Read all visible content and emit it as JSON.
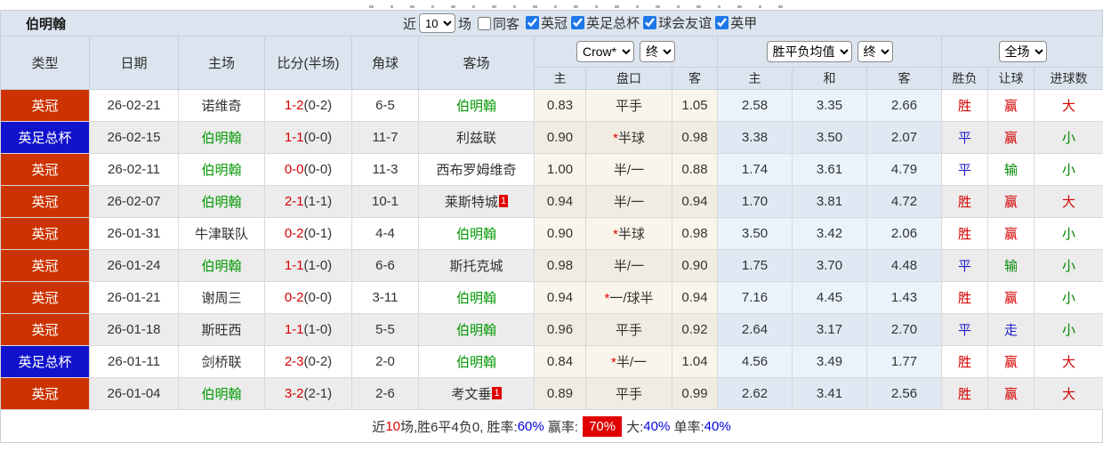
{
  "header": {
    "team": "伯明翰",
    "recent_label": "近",
    "recent_value": "10",
    "matches_label": "场",
    "same_opponent": {
      "label": "同客",
      "checked": false
    },
    "league_filters": [
      {
        "label": "英冠",
        "checked": true
      },
      {
        "label": "英足总杯",
        "checked": true
      },
      {
        "label": "球会友谊",
        "checked": true
      },
      {
        "label": "英甲",
        "checked": true
      }
    ]
  },
  "table": {
    "main_headers": [
      "类型",
      "日期",
      "主场",
      "比分(半场)",
      "角球",
      "客场"
    ],
    "selects": {
      "company": "Crow*",
      "company_time": "终",
      "mean": "胜平负均值",
      "mean_time": "终",
      "scope": "全场"
    },
    "sub_headers": [
      "主",
      "盘口",
      "客",
      "主",
      "和",
      "客",
      "胜负",
      "让球",
      "进球数"
    ],
    "rows": [
      {
        "league": "英冠",
        "league_bg": "#cc3300",
        "date": "26-02-21",
        "home": "诺维奇",
        "score": "1-2",
        "half": "(0-2)",
        "corners": "6-5",
        "away": "伯明翰",
        "odds_home": "0.83",
        "handicap": "平手",
        "odds_away": "1.05",
        "mean_home": "2.58",
        "mean_draw": "3.35",
        "mean_away": "2.66",
        "result": "胜",
        "handicap_result": "赢",
        "goals": "大"
      },
      {
        "league": "英足总杯",
        "league_bg": "#1212cc",
        "date": "26-02-15",
        "home": "伯明翰",
        "score": "1-1",
        "half": "(0-0)",
        "corners": "11-7",
        "away": "利兹联",
        "odds_home": "0.90",
        "handicap": "*半球",
        "odds_away": "0.98",
        "mean_home": "3.38",
        "mean_draw": "3.50",
        "mean_away": "2.07",
        "result": "平",
        "handicap_result": "赢",
        "goals": "小"
      },
      {
        "league": "英冠",
        "league_bg": "#cc3300",
        "date": "26-02-11",
        "home": "伯明翰",
        "score": "0-0",
        "half": "(0-0)",
        "corners": "11-3",
        "away": "西布罗姆维奇",
        "odds_home": "1.00",
        "handicap": "半/一",
        "odds_away": "0.88",
        "mean_home": "1.74",
        "mean_draw": "3.61",
        "mean_away": "4.79",
        "result": "平",
        "handicap_result": "输",
        "goals": "小"
      },
      {
        "league": "英冠",
        "league_bg": "#cc3300",
        "date": "26-02-07",
        "home": "伯明翰",
        "score": "2-1",
        "half": "(1-1)",
        "corners": "10-1",
        "away": "莱斯特城",
        "away_badge": "1",
        "odds_home": "0.94",
        "handicap": "半/一",
        "odds_away": "0.94",
        "mean_home": "1.70",
        "mean_draw": "3.81",
        "mean_away": "4.72",
        "result": "胜",
        "handicap_result": "赢",
        "goals": "大"
      },
      {
        "league": "英冠",
        "league_bg": "#cc3300",
        "date": "26-01-31",
        "home": "牛津联队",
        "score": "0-2",
        "half": "(0-1)",
        "corners": "4-4",
        "away": "伯明翰",
        "odds_home": "0.90",
        "handicap": "*半球",
        "odds_away": "0.98",
        "mean_home": "3.50",
        "mean_draw": "3.42",
        "mean_away": "2.06",
        "result": "胜",
        "handicap_result": "赢",
        "goals": "小"
      },
      {
        "league": "英冠",
        "league_bg": "#cc3300",
        "date": "26-01-24",
        "home": "伯明翰",
        "score": "1-1",
        "half": "(1-0)",
        "corners": "6-6",
        "away": "斯托克城",
        "odds_home": "0.98",
        "handicap": "半/一",
        "odds_away": "0.90",
        "mean_home": "1.75",
        "mean_draw": "3.70",
        "mean_away": "4.48",
        "result": "平",
        "handicap_result": "输",
        "goals": "小"
      },
      {
        "league": "英冠",
        "league_bg": "#cc3300",
        "date": "26-01-21",
        "home": "谢周三",
        "score": "0-2",
        "half": "(0-0)",
        "corners": "3-11",
        "away": "伯明翰",
        "odds_home": "0.94",
        "handicap": "*一/球半",
        "odds_away": "0.94",
        "mean_home": "7.16",
        "mean_draw": "4.45",
        "mean_away": "1.43",
        "result": "胜",
        "handicap_result": "赢",
        "goals": "小"
      },
      {
        "league": "英冠",
        "league_bg": "#cc3300",
        "date": "26-01-18",
        "home": "斯旺西",
        "score": "1-1",
        "half": "(1-0)",
        "corners": "5-5",
        "away": "伯明翰",
        "odds_home": "0.96",
        "handicap": "平手",
        "odds_away": "0.92",
        "mean_home": "2.64",
        "mean_draw": "3.17",
        "mean_away": "2.70",
        "result": "平",
        "handicap_result": "走",
        "goals": "小"
      },
      {
        "league": "英足总杯",
        "league_bg": "#1212cc",
        "date": "26-01-11",
        "home": "剑桥联",
        "score": "2-3",
        "half": "(0-2)",
        "corners": "2-0",
        "away": "伯明翰",
        "odds_home": "0.84",
        "handicap": "*半/一",
        "odds_away": "1.04",
        "mean_home": "4.56",
        "mean_draw": "3.49",
        "mean_away": "1.77",
        "result": "胜",
        "handicap_result": "赢",
        "goals": "大"
      },
      {
        "league": "英冠",
        "league_bg": "#cc3300",
        "date": "26-01-04",
        "home": "伯明翰",
        "score": "3-2",
        "half": "(2-1)",
        "corners": "2-6",
        "away": "考文垂",
        "away_badge": "1",
        "odds_home": "0.89",
        "handicap": "平手",
        "odds_away": "0.99",
        "mean_home": "2.62",
        "mean_draw": "3.41",
        "mean_away": "2.56",
        "result": "胜",
        "handicap_result": "赢",
        "goals": "大"
      }
    ]
  },
  "colors": {
    "胜": "#d40000",
    "平": "#2121cc",
    "赢": "#d40000",
    "输": "#008800",
    "走": "#2121cc",
    "大": "#d40000",
    "小": "#008800"
  },
  "footer_segments": [
    {
      "text": "近",
      "color": "#333333"
    },
    {
      "text": "10",
      "color": "#e00000"
    },
    {
      "text": "场,胜6平4负0, 胜率:",
      "color": "#333333"
    },
    {
      "text": "60%",
      "color": "#0000e0"
    },
    {
      "text": " 赢率:",
      "color": "#333333"
    },
    {
      "text": "70%",
      "color": "#ffffff",
      "bg": "#e00000"
    },
    {
      "text": "大:",
      "color": "#333333"
    },
    {
      "text": "40%",
      "color": "#0000e0"
    },
    {
      "text": " 单率:",
      "color": "#333333"
    },
    {
      "text": "40%",
      "color": "#0000e0"
    }
  ]
}
